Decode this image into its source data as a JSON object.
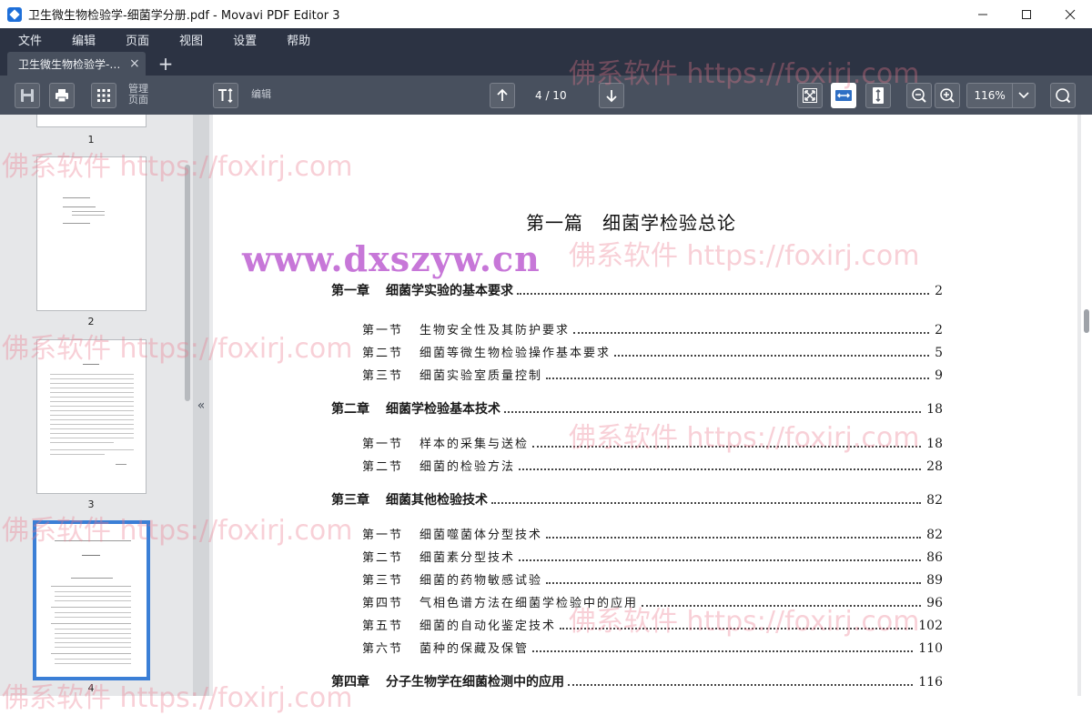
{
  "window": {
    "title": "卫生微生物检验学-细菌学分册.pdf - Movavi PDF Editor 3"
  },
  "menu": {
    "items": [
      "文件",
      "编辑",
      "页面",
      "视图",
      "设置",
      "帮助"
    ]
  },
  "tabs": {
    "active_label": "卫生微生物检验学-…",
    "close_glyph": "×",
    "add_glyph": "+"
  },
  "toolbar": {
    "manage_pages_label": "管理页面",
    "edit_label": "编辑",
    "page_indicator": "4 / 10",
    "zoom": "116%"
  },
  "sidebar": {
    "collapse_glyph": "«",
    "thumbnails": [
      {
        "number": "1"
      },
      {
        "number": "2"
      },
      {
        "number": "3"
      },
      {
        "number": "4",
        "selected": true
      }
    ]
  },
  "document": {
    "title": "第一篇　细菌学检验总论",
    "watermark_url": "www.dxszyw.cn",
    "toc": [
      {
        "type": "chapter",
        "num": "第一章",
        "text": "细菌学实验的基本要求",
        "page": "2"
      },
      {
        "type": "section",
        "num": "第一节",
        "text": "生物安全性及其防护要求",
        "page": "2"
      },
      {
        "type": "section",
        "num": "第二节",
        "text": "细菌等微生物检验操作基本要求",
        "page": "5"
      },
      {
        "type": "section",
        "num": "第三节",
        "text": "细菌实验室质量控制",
        "page": "9"
      },
      {
        "type": "chapter",
        "num": "第二章",
        "text": "细菌学检验基本技术",
        "page": "18"
      },
      {
        "type": "section",
        "num": "第一节",
        "text": "样本的采集与送检",
        "page": "18"
      },
      {
        "type": "section",
        "num": "第二节",
        "text": "细菌的检验方法",
        "page": "28"
      },
      {
        "type": "chapter",
        "num": "第三章",
        "text": "细菌其他检验技术",
        "page": "82"
      },
      {
        "type": "section",
        "num": "第一节",
        "text": "细菌噬菌体分型技术",
        "page": "82"
      },
      {
        "type": "section",
        "num": "第二节",
        "text": "细菌素分型技术",
        "page": "86"
      },
      {
        "type": "section",
        "num": "第三节",
        "text": "细菌的药物敏感试验",
        "page": "89"
      },
      {
        "type": "section",
        "num": "第四节",
        "text": "气相色谱方法在细菌学检验中的应用",
        "page": "96"
      },
      {
        "type": "section",
        "num": "第五节",
        "text": "细菌的自动化鉴定技术",
        "page": "102"
      },
      {
        "type": "section",
        "num": "第六节",
        "text": "菌种的保藏及保管",
        "page": "110"
      },
      {
        "type": "chapter",
        "num": "第四章",
        "text": "分子生物学在细菌检测中的应用",
        "page": "116"
      }
    ]
  },
  "watermark": {
    "text": "佛系软件 https://foxirj.com"
  }
}
